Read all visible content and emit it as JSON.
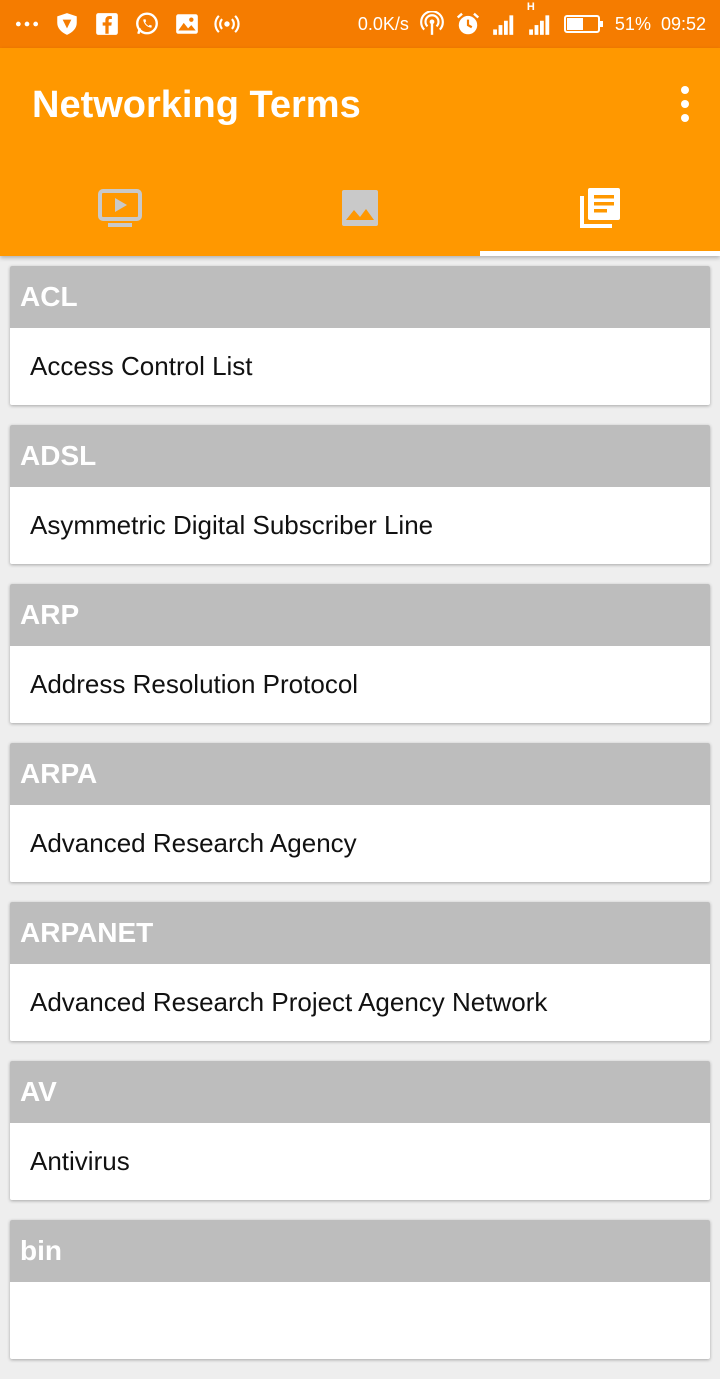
{
  "status_bar": {
    "network_speed": "0.0K/s",
    "network_type": "H",
    "battery": "51%",
    "time": "09:52",
    "icons": [
      "more-icon",
      "vpn-shield-icon",
      "facebook-icon",
      "whatsapp-icon",
      "gallery-icon",
      "hotspot-icon",
      "wireless-icon",
      "alarm-icon",
      "signal-icon",
      "signal-h-icon",
      "battery-icon"
    ]
  },
  "app_bar": {
    "title": "Networking Terms",
    "menu_icon": "overflow-menu-icon",
    "accent": "#ff9800",
    "status_color": "#f57c00"
  },
  "tabs": [
    {
      "icon": "video-icon",
      "active": false
    },
    {
      "icon": "image-icon",
      "active": false
    },
    {
      "icon": "library-icon",
      "active": true
    }
  ],
  "terms": [
    {
      "abbr": "ACL",
      "full": "Access Control List"
    },
    {
      "abbr": "ADSL",
      "full": "Asymmetric Digital Subscriber Line"
    },
    {
      "abbr": "ARP",
      "full": "Address Resolution Protocol"
    },
    {
      "abbr": "ARPA",
      "full": "Advanced Research Agency"
    },
    {
      "abbr": "ARPANET",
      "full": "Advanced Research Project Agency Network"
    },
    {
      "abbr": "AV",
      "full": "Antivirus"
    },
    {
      "abbr": "bin",
      "full": ""
    }
  ]
}
